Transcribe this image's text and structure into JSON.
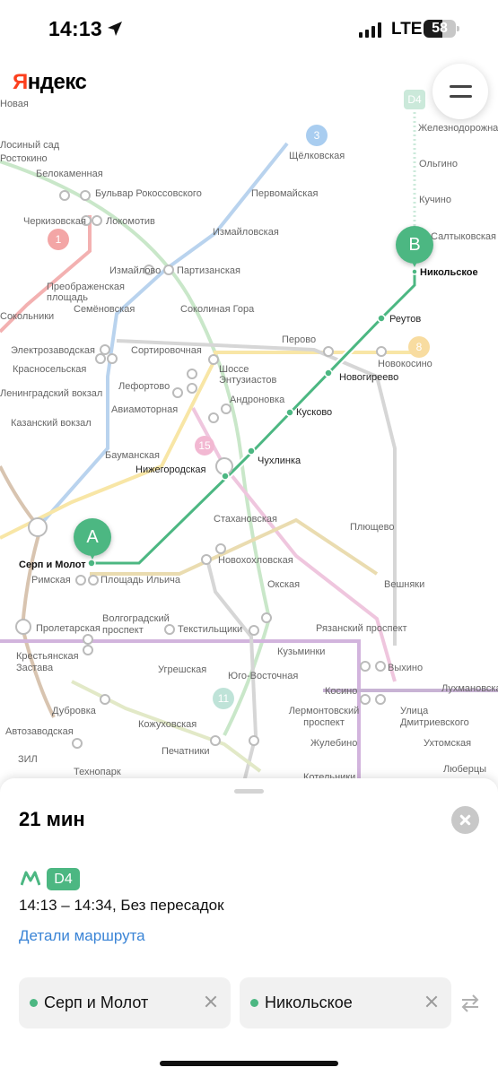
{
  "status_bar": {
    "time": "14:13",
    "network": "LTE",
    "battery": "58",
    "battery_fraction": 0.58
  },
  "map": {
    "logo": "Яндекс",
    "line_badges": [
      "3",
      "1",
      "15",
      "11",
      "8",
      "D4"
    ],
    "route": {
      "start_pin": "A",
      "end_pin": "B",
      "route_color": "#4cb782"
    },
    "stations_route": [
      "Серп и Молот",
      "Нижегородская",
      "Чухлинка",
      "Кусково",
      "Новогиреево",
      "Реутов",
      "Никольское"
    ],
    "stations": [
      "Бульвар Рокоссовского",
      "Белокаменная",
      "Локомотив",
      "Черкизовская",
      "Щёлковская",
      "Первомайская",
      "Измайловская",
      "Измайлово",
      "Партизанская",
      "Преображенская площадь",
      "Семёновская",
      "Соколиная Гора",
      "Электрозаводская",
      "Сортировочная",
      "Перово",
      "Шоссе Энтузиастов",
      "Красносельская",
      "Лефортово",
      "Андроновка",
      "Ленинградский вокзал",
      "Казанский вокзал",
      "Авиамоторная",
      "Бауманская",
      "Плющево",
      "Стахановская",
      "Новохохловская",
      "Площадь Ильича",
      "Римская",
      "Вешняки",
      "Окская",
      "Пролетарская",
      "Волгоградский проспект",
      "Текстильщики",
      "Рязанский проспект",
      "Крестьянская Застава",
      "Кузьминки",
      "Выхино",
      "Угрешская",
      "Юго-Восточная",
      "Косино",
      "Лухмановская",
      "Дубровка",
      "Лермонтовский проспект",
      "Улица Дмитриевского",
      "Автозаводская",
      "Кожуховская",
      "Жулебино",
      "Ухтомская",
      "ЗИЛ",
      "Печатники",
      "Технопарк",
      "Котельники",
      "Люберцы",
      "Железнодорожная",
      "Ольгино",
      "Кучино",
      "Салтыковская",
      "Новокосино",
      "Сокольники",
      "Ростокино",
      "Лосиный сад",
      "Новая",
      "Ильича"
    ]
  },
  "panel": {
    "duration": "21 мин",
    "line_badge": "D4",
    "time_range": "14:13 – 14:34, Без пересадок",
    "details_link": "Детали маршрута",
    "from": "Серп и Молот",
    "to": "Никольское"
  }
}
